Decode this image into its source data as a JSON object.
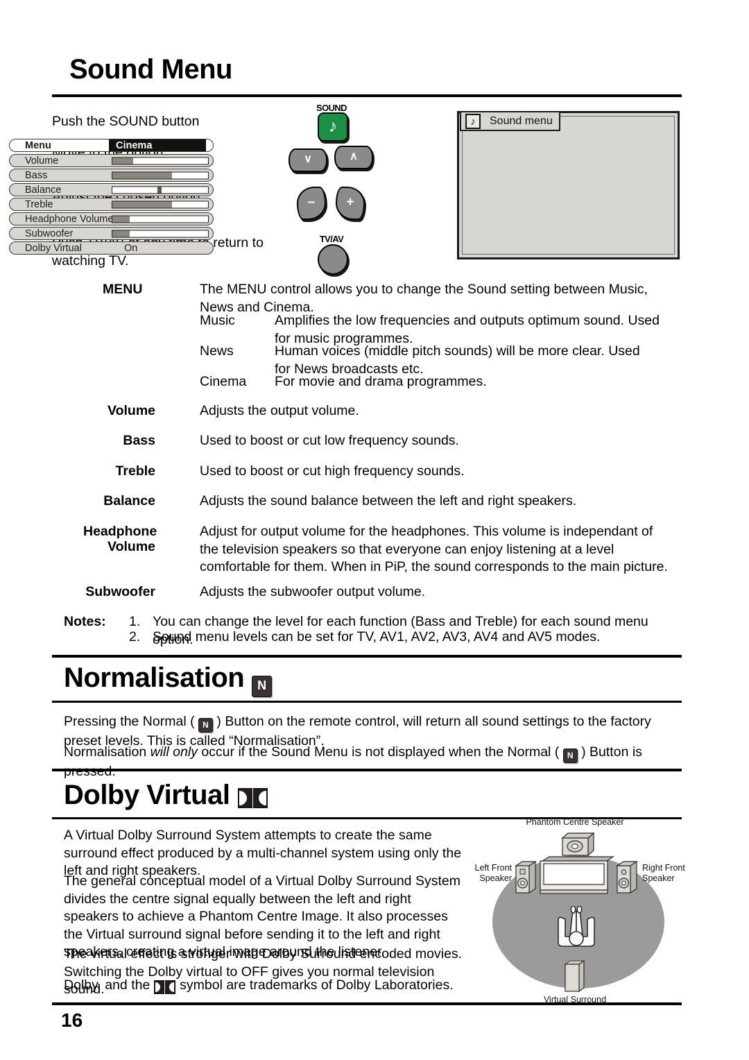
{
  "page": {
    "number": "16"
  },
  "section_sound": {
    "title": "Sound Menu",
    "steps": [
      {
        "text": "Push the SOUND button",
        "key_label": "SOUND",
        "key_icon": "music-note-icon"
      },
      {
        "text": "Move to the option",
        "key_label": "",
        "key_icon": "chevron-down-icon / chevron-up-icon"
      },
      {
        "text": "Adjust the chosen option",
        "key_label": "",
        "key_icon": "minus-icon / plus-icon"
      },
      {
        "text": "Push TV/AV at any time to return to watching TV.",
        "key_label": "TV/AV",
        "key_icon": "round-button-icon"
      }
    ],
    "step_keys": {
      "minus": "–",
      "plus": "+",
      "down": "∨",
      "up": "∧",
      "note": "♪"
    }
  },
  "osd": {
    "tab_title": "Sound menu",
    "tab_icon": "music-note-icon",
    "rows": [
      {
        "label": "Menu",
        "type": "value",
        "value": "Cinema"
      },
      {
        "label": "Volume",
        "type": "bar",
        "fill": 22
      },
      {
        "label": "Bass",
        "type": "bar",
        "fill": 62
      },
      {
        "label": "Balance",
        "type": "center",
        "fill": 49
      },
      {
        "label": "Treble",
        "type": "bar",
        "fill": 62
      },
      {
        "label": "Headphone Volume",
        "type": "bar",
        "fill": 18
      },
      {
        "label": "Subwoofer",
        "type": "bar",
        "fill": 18
      },
      {
        "label": "Dolby Virtual",
        "type": "text",
        "value": "On"
      }
    ]
  },
  "descriptions": {
    "menu": {
      "term": "MENU",
      "body": "The MENU control allows you to change the Sound setting between Music, News and Cinema.",
      "sub": [
        {
          "term": "Music",
          "body": "Amplifies the low frequencies and outputs optimum sound. Used for music programmes."
        },
        {
          "term": "News",
          "body": "Human voices (middle pitch sounds) will be more clear. Used for News broadcasts etc."
        },
        {
          "term": "Cinema",
          "body": "For movie and drama programmes."
        }
      ]
    },
    "items": [
      {
        "term": "Volume",
        "term2": "",
        "body": "Adjusts the output volume."
      },
      {
        "term": "Bass",
        "term2": "",
        "body": "Used to boost or cut low frequency sounds."
      },
      {
        "term": "Treble",
        "term2": "",
        "body": "Used to boost or cut high frequency sounds."
      },
      {
        "term": "Balance",
        "term2": "",
        "body": "Adjusts the sound balance between the left and right speakers."
      },
      {
        "term": "Headphone",
        "term2": "Volume",
        "body": "Adjust for output volume for the headphones. This volume is independant of the television speakers so that everyone can enjoy listening at a level comfortable for them. When in PiP, the sound corresponds to the main picture."
      },
      {
        "term": "Subwoofer",
        "term2": "",
        "body": "Adjusts the subwoofer output volume."
      }
    ],
    "notes_label": "Notes:",
    "notes": [
      {
        "num": "1.",
        "text": "You can change the level for each function (Bass and Treble) for each sound menu option."
      },
      {
        "num": "2.",
        "text": "Sound menu levels can be set for TV, AV1, AV2, AV3, AV4 and AV5 modes."
      }
    ]
  },
  "section_normalisation": {
    "title": "Normalisation",
    "title_icon": "normal-button-icon",
    "para1_a": "Pressing the Normal ( ",
    "para1_b": " ) Button on the remote control, will return all sound settings to the factory preset levels. This is called “Normalisation”.",
    "para2_a": "Normalisation ",
    "para2_em": "will only",
    "para2_b": " occur if the Sound Menu is not displayed when the Normal ( ",
    "para2_c": " ) Button is pressed."
  },
  "section_dolby": {
    "title": "Dolby Virtual",
    "title_icon": "dolby-double-d-icon",
    "paragraphs": [
      "A Virtual Dolby Surround System attempts to create the same surround effect produced by a multi-channel system using only the left and right speakers.",
      "The general conceptual model of a Virtual Dolby Surround System divides the centre signal equally between the left and right speakers to achieve a Phantom Centre Image. It also processes the Virtual surround signal before sending it to the left and right speakers, creating a virtual image around the listener.",
      "The virtual effect is stronger with Dolby Surround encoded movies. Switching the Dolby virtual to OFF gives you normal television sound."
    ],
    "trademark_a": "Dolby, and the ",
    "trademark_b": " symbol are trademarks of Dolby Laboratories.",
    "diagram": {
      "phantom_centre": "Phantom Centre Speaker",
      "left_front": "Left Front\nSpeaker",
      "left_front_l1": "Left Front",
      "left_front_l2": "Speaker",
      "right_front_l1": "Right Front",
      "right_front_l2": "Speaker",
      "virtual_surround": "Virtual Surround"
    }
  },
  "colors": {
    "sound_key_green": "#1a8f45",
    "key_grey": "#8a8a8a",
    "osd_bg": "#d8d6d2",
    "osd_bar_fill": "#8a8780",
    "diagram_oval": "#9b9b9b"
  }
}
